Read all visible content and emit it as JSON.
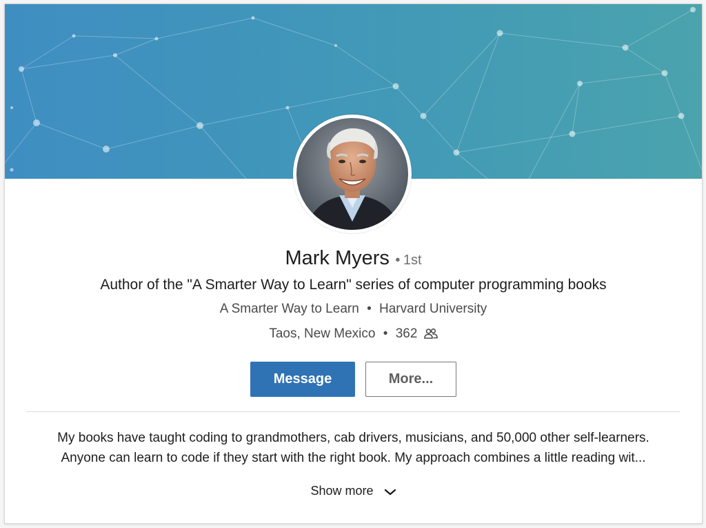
{
  "profile": {
    "name": "Mark Myers",
    "degree_separator": "•",
    "degree": "1st",
    "headline": "Author of the \"A Smarter Way to Learn\" series of computer programming books",
    "company": "A Smarter Way to Learn",
    "school": "Harvard University",
    "location": "Taos, New Mexico",
    "connections": "362",
    "separator": "•"
  },
  "actions": {
    "message_label": "Message",
    "more_label": "More..."
  },
  "summary": {
    "line1": "My books have taught coding to grandmothers, cab drivers, musicians, and 50,000 other self-learners.",
    "line2": "Anyone can learn to code if they start with the right book. My approach combines a little reading wit...",
    "show_more_label": "Show more"
  },
  "icons": {
    "connections": "people-icon",
    "show_more": "chevron-down-icon"
  },
  "colors": {
    "primary_button": "#2f73b4",
    "banner_start": "#3f8ec2",
    "banner_end": "#4aa3ad"
  }
}
